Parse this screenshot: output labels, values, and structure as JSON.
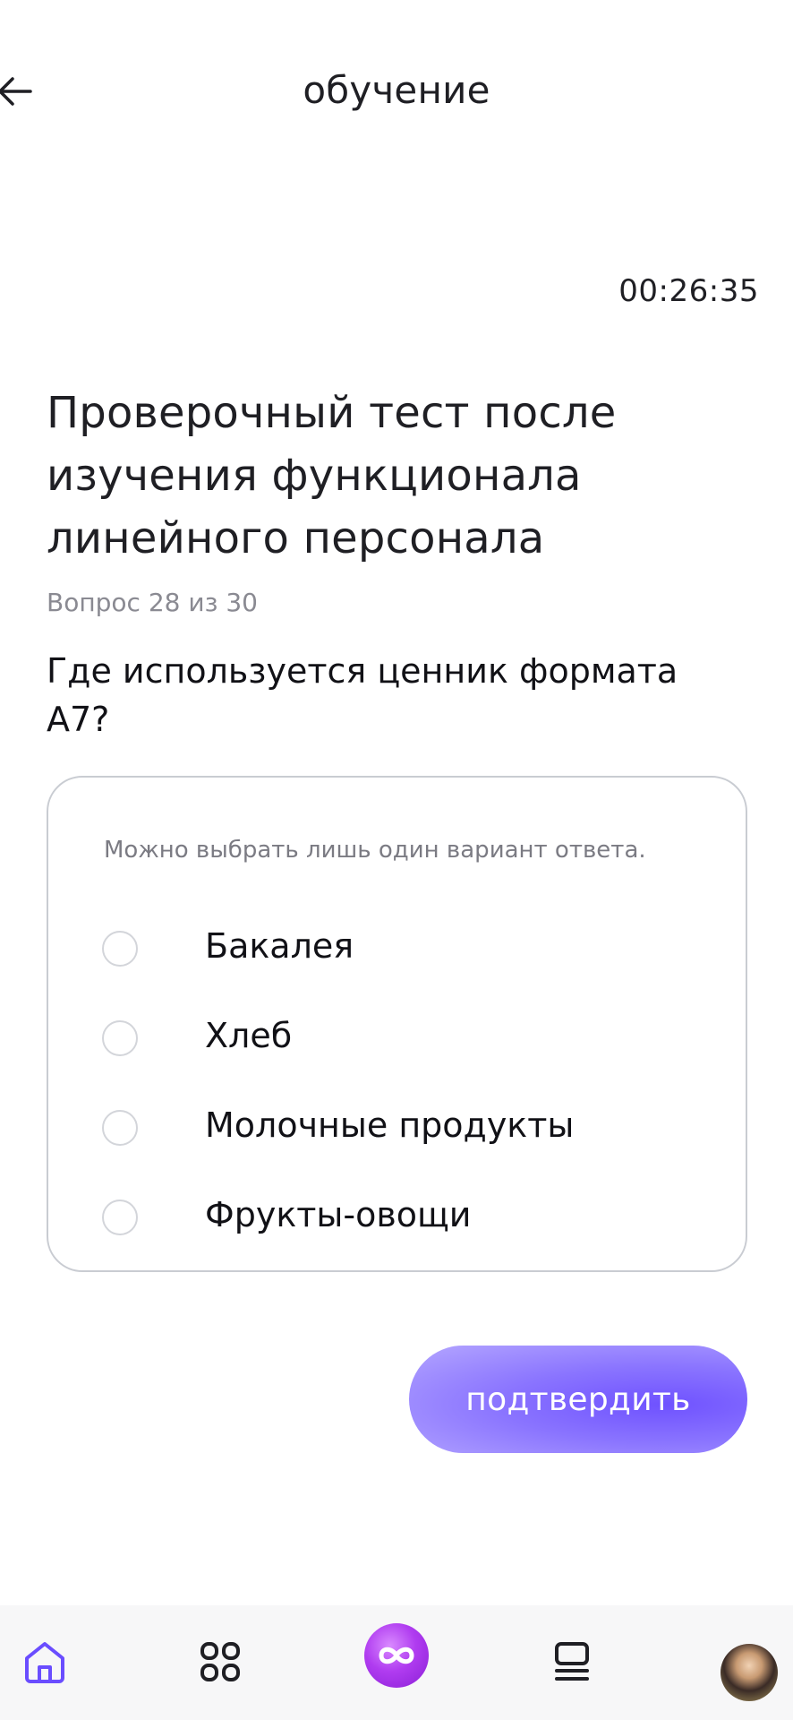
{
  "header": {
    "title": "обучение",
    "back_icon": "arrow-left-icon"
  },
  "timer": "00:26:35",
  "test": {
    "title_lines": [
      "Проверочный тест после",
      "изучения функционала",
      "линейного персонала"
    ],
    "counter": "Вопрос 28 из 30",
    "question_lines": [
      "Где используется ценник формата",
      "А7?"
    ]
  },
  "answers": {
    "hint": "Можно выбрать лишь один вариант ответа.",
    "options": [
      {
        "label": "Бакалея",
        "selected": false
      },
      {
        "label": "Хлеб",
        "selected": false
      },
      {
        "label": "Молочные продукты",
        "selected": false
      },
      {
        "label": "Фрукты-овощи",
        "selected": false
      }
    ]
  },
  "confirm_label": "подтвердить",
  "colors": {
    "accent": "#6f52ff",
    "nav_home": "#6a4dff",
    "center_button": "#b03cf0"
  },
  "nav": {
    "items": [
      {
        "icon": "home-icon",
        "active": true
      },
      {
        "icon": "apps-grid-icon",
        "active": false
      },
      {
        "icon": "infinity-icon",
        "active": false
      },
      {
        "icon": "courses-stack-icon",
        "active": false
      },
      {
        "icon": "avatar",
        "active": false
      }
    ]
  }
}
